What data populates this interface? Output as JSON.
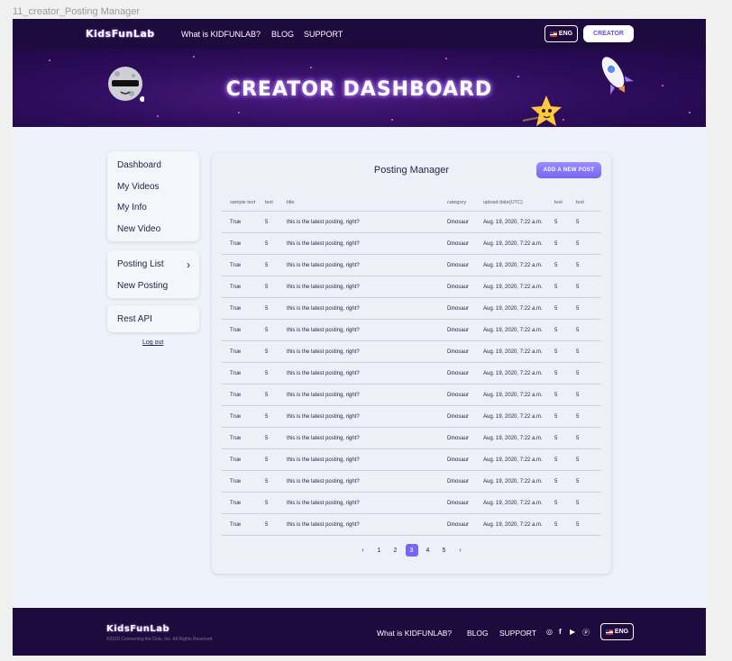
{
  "frame_label": "11_creator_Posting Manager",
  "header": {
    "logo": "KidsFunLab",
    "nav": [
      "What is KIDFUNLAB?",
      "BLOG",
      "SUPPORT"
    ],
    "lang_label": "ENG",
    "creator_label": "CREATOR"
  },
  "banner": {
    "title": "CREATOR DASHBOARD"
  },
  "sidebar": {
    "group1": [
      "Dashboard",
      "My Videos",
      "My Info",
      "New Video"
    ],
    "group2": [
      "Posting List",
      "New Posting"
    ],
    "group3": [
      "Rest API"
    ],
    "logout": "Log out"
  },
  "main": {
    "title": "Posting Manager",
    "add_button": "ADD A NEW POST",
    "columns": [
      "sample text",
      "text",
      "title",
      "category",
      "upload date(UTC)",
      "text",
      "text"
    ],
    "rows": [
      [
        "True",
        "5",
        "this is the latest posting, right?",
        "Dinosaur",
        "Aug. 19, 2020, 7:22 a.m.",
        "5",
        "5"
      ],
      [
        "True",
        "5",
        "this is the latest posting, right?",
        "Dinosaur",
        "Aug. 19, 2020, 7:22 a.m.",
        "5",
        "5"
      ],
      [
        "True",
        "5",
        "this is the latest posting, right?",
        "Dinosaur",
        "Aug. 19, 2020, 7:22 a.m.",
        "5",
        "5"
      ],
      [
        "True",
        "5",
        "this is the latest posting, right?",
        "Dinosaur",
        "Aug. 19, 2020, 7:22 a.m.",
        "5",
        "5"
      ],
      [
        "True",
        "5",
        "this is the latest posting, right?",
        "Dinosaur",
        "Aug. 19, 2020, 7:22 a.m.",
        "5",
        "5"
      ],
      [
        "True",
        "5",
        "this is the latest posting, right?",
        "Dinosaur",
        "Aug. 19, 2020, 7:22 a.m.",
        "5",
        "5"
      ],
      [
        "True",
        "5",
        "this is the latest posting, right?",
        "Dinosaur",
        "Aug. 19, 2020, 7:22 a.m.",
        "5",
        "5"
      ],
      [
        "True",
        "5",
        "this is the latest posting, right?",
        "Dinosaur",
        "Aug. 19, 2020, 7:22 a.m.",
        "5",
        "5"
      ],
      [
        "True",
        "5",
        "this is the latest posting, right?",
        "Dinosaur",
        "Aug. 19, 2020, 7:22 a.m.",
        "5",
        "5"
      ],
      [
        "True",
        "5",
        "this is the latest posting, right?",
        "Dinosaur",
        "Aug. 19, 2020, 7:22 a.m.",
        "5",
        "5"
      ],
      [
        "True",
        "5",
        "this is the latest posting, right?",
        "Dinosaur",
        "Aug. 19, 2020, 7:22 a.m.",
        "5",
        "5"
      ],
      [
        "True",
        "5",
        "this is the latest posting, right?",
        "Dinosaur",
        "Aug. 19, 2020, 7:22 a.m.",
        "5",
        "5"
      ],
      [
        "True",
        "5",
        "this is the latest posting, right?",
        "Dinosaur",
        "Aug. 19, 2020, 7:22 a.m.",
        "5",
        "5"
      ],
      [
        "True",
        "5",
        "this is the latest posting, right?",
        "Dinosaur",
        "Aug. 19, 2020, 7:22 a.m.",
        "5",
        "5"
      ],
      [
        "True",
        "5",
        "this is the latest posting, right?",
        "Dinosaur",
        "Aug. 19, 2020, 7:22 a.m.",
        "5",
        "5"
      ]
    ],
    "pagination": {
      "prev": "‹",
      "pages": [
        "1",
        "2",
        "3",
        "4",
        "5"
      ],
      "active_page": "3",
      "next": "›"
    }
  },
  "footer": {
    "logo": "KidsFunLab",
    "copyright": "©2020 Connecting the Dots, Inc. All Rights Reserved",
    "nav": [
      "What is KIDFUNLAB?",
      "BLOG",
      "SUPPORT"
    ],
    "social_icons": [
      "instagram-icon",
      "facebook-icon",
      "youtube-icon",
      "pinterest-icon"
    ],
    "lang_label": "ENG"
  },
  "colors": {
    "accent": "#7b66f0",
    "header_bg": "#1d0b3e",
    "page_bg": "#eef3fb"
  }
}
